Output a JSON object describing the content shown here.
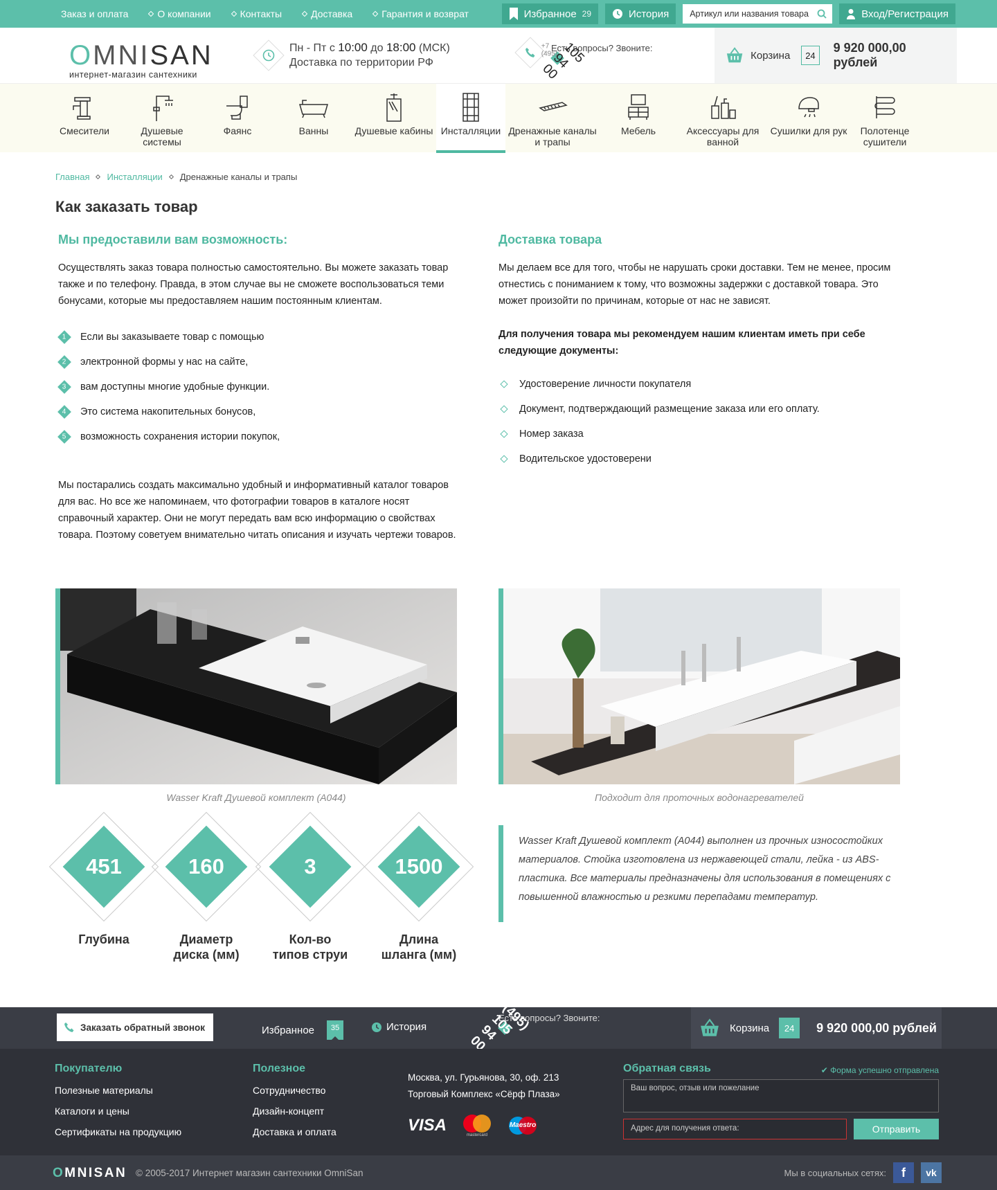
{
  "topnav": {
    "items": [
      "Заказ и оплата",
      "О компании",
      "Контакты",
      "Доставка",
      "Гарантия и возврат"
    ],
    "favorites_label": "Избранное",
    "favorites_count": "29",
    "history_label": "История",
    "search_placeholder": "Артикул или названия товара",
    "login_label": "Вход/Регистрация"
  },
  "header": {
    "logo_omni": "OMNI",
    "logo_san": "SAN",
    "logo_sub": "интернет-магазин сантехники",
    "hours_prefix": "Пн - Пт с ",
    "hours_from": "10:00",
    "hours_mid": " до ",
    "hours_to": "18:00",
    "hours_suffix": " (МСК)",
    "delivery": "Доставка по территории РФ",
    "phone_label": "Есть вопросы? Звоните:",
    "phone_code": "+7 (495)",
    "phone_number": " 105 94 00",
    "cart_label": "Корзина",
    "cart_count": "24",
    "cart_sum": "9 920 000,00 рублей"
  },
  "categories": [
    {
      "label": "Смесители",
      "icon": "faucet-icon"
    },
    {
      "label": "Душевые системы",
      "icon": "shower-system-icon"
    },
    {
      "label": "Фаянс",
      "icon": "toilet-icon"
    },
    {
      "label": "Ванны",
      "icon": "bathtub-icon"
    },
    {
      "label": "Душевые кабины",
      "icon": "shower-cabin-icon"
    },
    {
      "label": "Инсталляции",
      "icon": "installation-icon",
      "active": true
    },
    {
      "label": "Дренажные каналы и трапы",
      "icon": "drain-icon"
    },
    {
      "label": "Мебель",
      "icon": "furniture-icon"
    },
    {
      "label": "Аксессуары для ванной",
      "icon": "accessories-icon"
    },
    {
      "label": "Сушилки для рук",
      "icon": "hand-dryer-icon"
    },
    {
      "label": "Полотенце сушители",
      "icon": "towel-dryer-icon"
    }
  ],
  "breadcrumb": {
    "home": "Главная",
    "section": "Инсталляции",
    "current": "Дренажные каналы и трапы"
  },
  "page_title": "Как заказать товар",
  "left": {
    "heading": "Мы предоставили вам возможность:",
    "intro": "Осуществлять заказ товара полностью самостоятельно. Вы можете заказать товар также и по телефону. Правда, в этом случае вы не сможете воспользоваться теми бонусами, которые мы предоставляем нашим постоянным клиентам.",
    "list": [
      {
        "n": "1",
        "t": "Если вы заказываете товар с помощью"
      },
      {
        "n": "2",
        "t": "электронной формы у нас на сайте,"
      },
      {
        "n": "3",
        "t": "вам доступны многие удобные функции."
      },
      {
        "n": "4",
        "t": "Это система накопительных бонусов,"
      },
      {
        "n": "5",
        "t": "возможность сохранения истории покупок,"
      }
    ],
    "outro": "Мы постарались создать максимально удобный и информативный каталог товаров для вас. Но все же напоминаем, что фотографии товаров в каталоге носят справочный характер. Они не могут передать вам всю информацию о свойствах товара. Поэтому советуем внимательно читать описания и изучать чертежи товаров.",
    "caption": "Wasser Kraft Душевой комплект (А044)"
  },
  "right": {
    "heading": "Доставка товара",
    "intro": "Мы делаем все для того, чтобы не нарушать сроки доставки. Тем не менее, просим отнестись с пониманием к тому, что возможны задержки с доставкой товара. Это может произойти по причинам, которые от нас не зависят.",
    "bold": "Для получения товара мы рекомендуем нашим клиентам иметь при себе следующие документы:",
    "list": [
      "Удостоверение личности покупателя",
      "Документ, подтверждающий размещение заказа или его оплату.",
      "Номер заказа",
      "Водительское удостоверени"
    ],
    "caption": "Подходит для проточных водонагревателей",
    "quote": "Wasser Kraft Душевой комплект (А044)  выполнен из прочных износостойких материалов. Стойка изготовлена из нержавеющей стали, лейка - из ABS-пластика. Все материалы предназначены для использования в помещениях с повышенной влажностью и резкими перепадами температур."
  },
  "stats": [
    {
      "value": "451",
      "l1": "Глубина",
      "l2": ""
    },
    {
      "value": "160",
      "l1": "Диаметр",
      "l2": "диска (мм)"
    },
    {
      "value": "3",
      "l1": "Кол-во",
      "l2": "типов струи"
    },
    {
      "value": "1500",
      "l1": "Длина",
      "l2": "шланга (мм)"
    }
  ],
  "footer": {
    "callback": "Заказать обратный звонок",
    "favorites_label": "Избранное",
    "favorites_count": "35",
    "history_label": "История",
    "phone_label": "Есть вопросы? Звоните:",
    "phone": "+7 (495) 105 94 00",
    "cart_label": "Корзина",
    "cart_count": "24",
    "cart_sum": "9 920 000,00 рублей",
    "col1_title": "Покупателю",
    "col1": [
      "Полезные материалы",
      "Каталоги и цены",
      "Сертификаты на продукцию"
    ],
    "col2_title": "Полезное",
    "col2": [
      "Сотрудничество",
      "Дизайн-концепт",
      "Доставка и оплата"
    ],
    "address1": "Москва, ул. Гурьянова, 30, оф. 213",
    "address2": "Торговый Комплекс «Сёрф Плаза»",
    "pay": [
      "VISA",
      "mastercard",
      "Maestro"
    ],
    "fb_title": "Обратная связь",
    "fb_ok": "Форма успешно отправлена",
    "fb_question": "Ваш вопрос, отзыв или пожелание",
    "fb_address": "Адрес для получения ответа:",
    "fb_send": "Отправить",
    "logo_omni": "OMNI",
    "logo_san": "SAN",
    "copyright": "© 2005-2017 Интернет магазин сантехники OmniSan",
    "social_label": "Мы в социальных сетях:"
  },
  "colors": {
    "accent": "#5cbfaa",
    "dark": "#3a3d45"
  }
}
